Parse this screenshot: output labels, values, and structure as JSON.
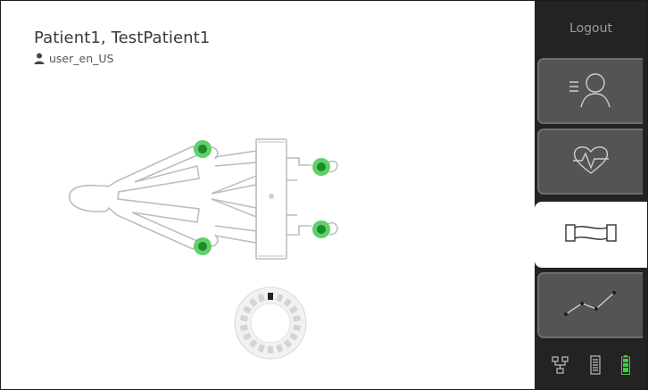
{
  "header": {
    "patient_name": "Patient1, TestPatient1",
    "user": "user_en_US",
    "user_icon": "person-icon"
  },
  "sidebar": {
    "logout_label": "Logout",
    "tabs": [
      {
        "name": "patient-summary",
        "icon": "patient-list-icon",
        "active": false
      },
      {
        "name": "vitals",
        "icon": "heart-pulse-icon",
        "active": false
      },
      {
        "name": "ecg-setup",
        "icon": "ecg-cable-icon",
        "active": true
      },
      {
        "name": "trends",
        "icon": "trend-graph-icon",
        "active": false
      }
    ],
    "status_icons": [
      "network-icon",
      "ecg-device-icon",
      "battery-icon"
    ]
  },
  "colors": {
    "sidebar_bg": "#232323",
    "tab_bg": "#525552",
    "electrode_green": "#2fbf3c",
    "battery_green": "#3bcf3b"
  }
}
